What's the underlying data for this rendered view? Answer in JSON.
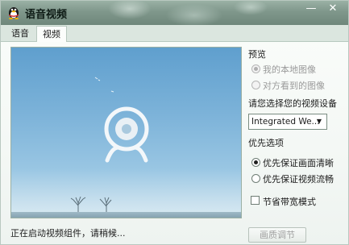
{
  "window": {
    "title": "语音视频",
    "app_icon": "qq-penguin-icon",
    "minimize_symbol": "—",
    "close_symbol": "✕"
  },
  "tabs": [
    {
      "label": "语音",
      "selected": false
    },
    {
      "label": "视频",
      "selected": true
    }
  ],
  "video": {
    "placeholder_icon": "webcam-icon"
  },
  "preview": {
    "heading": "预览",
    "options": [
      {
        "label": "我的本地图像",
        "selected": true,
        "enabled": false
      },
      {
        "label": "对方看到的图像",
        "selected": false,
        "enabled": false
      }
    ]
  },
  "device": {
    "heading": "请您选择您的视频设备",
    "selected": "Integrated We...",
    "arrow": "▼"
  },
  "priority": {
    "heading": "优先选项",
    "options": [
      {
        "label": "优先保证画面清晰",
        "selected": true
      },
      {
        "label": "优先保证视频流畅",
        "selected": false
      }
    ]
  },
  "bandwidth": {
    "label": "节省带宽模式",
    "checked": false
  },
  "status_text": "正在启动视频组件，请稍候...",
  "quality_button": {
    "label": "画质调节",
    "enabled": false
  },
  "colors": {
    "titlebar": "#7f978b",
    "sky_top": "#5f9fce",
    "sky_bottom": "#b6d6e8"
  }
}
